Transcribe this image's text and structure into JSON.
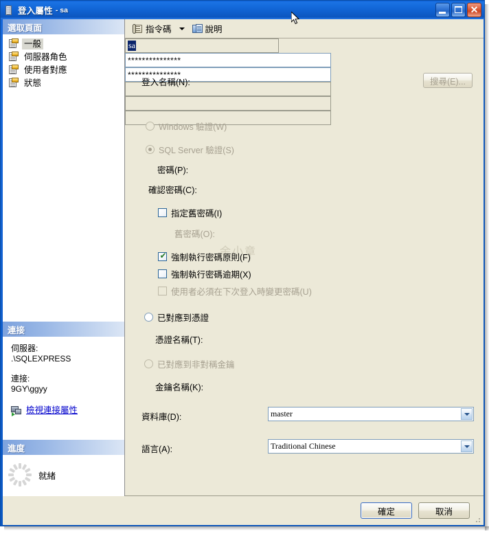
{
  "window": {
    "title": "登入屬性",
    "title_suffix": "- sa",
    "buttons": {
      "minimize": "_",
      "maximize": "□",
      "close": "✕"
    }
  },
  "sidebar": {
    "header": "選取頁面",
    "items": [
      {
        "label": "一般",
        "selected": true
      },
      {
        "label": "伺服器角色",
        "selected": false
      },
      {
        "label": "使用者對應",
        "selected": false
      },
      {
        "label": "狀態",
        "selected": false
      }
    ],
    "connection": {
      "header": "連接",
      "server_label": "伺服器:",
      "server_value": ".\\SQLEXPRESS",
      "connection_label": "連接:",
      "connection_value": "9GY\\ggyy",
      "link": "檢視連接屬性"
    },
    "progress": {
      "header": "進度",
      "status": "就緒"
    }
  },
  "toolbar": {
    "script_label": "指令碼",
    "help_label": "說明"
  },
  "form": {
    "login_name_label": "登入名稱(N):",
    "login_name_value": "sa",
    "search_button": "搜尋(E)...",
    "windows_auth_label": "Windows 驗證(W)",
    "windows_auth_selected": false,
    "windows_auth_disabled": true,
    "sql_auth_label": "SQL Server 驗證(S)",
    "sql_auth_selected": true,
    "sql_auth_disabled": true,
    "password_label": "密碼(P):",
    "password_value": "***************",
    "confirm_password_label": "確認密碼(C):",
    "confirm_password_value": "***************",
    "specify_old_password_label": "指定舊密碼(I)",
    "specify_old_password_checked": false,
    "old_password_label": "舊密碼(O):",
    "old_password_value": "",
    "enforce_policy_label": "強制執行密碼原則(F)",
    "enforce_policy_checked": true,
    "enforce_expiration_label": "強制執行密碼逾期(X)",
    "enforce_expiration_checked": false,
    "must_change_label": "使用者必須在下次登入時變更密碼(U)",
    "must_change_checked": false,
    "must_change_disabled": true,
    "mapped_to_certificate_label": "已對應到憑證",
    "mapped_to_certificate_selected": false,
    "certificate_name_label": "憑證名稱(T):",
    "certificate_name_value": "",
    "mapped_to_asymmetric_key_label": "已對應到非對稱金鑰",
    "mapped_to_asymmetric_key_selected": false,
    "mapped_to_asymmetric_key_disabled": true,
    "key_name_label": "金鑰名稱(K):",
    "key_name_value": "",
    "database_label": "資料庫(D):",
    "database_value": "master",
    "language_label": "語言(A):",
    "language_value": "Traditional Chinese"
  },
  "footer": {
    "ok": "確定",
    "cancel": "取消"
  },
  "watermark": "余小章",
  "colors": {
    "title_blue": "#0a5fd0",
    "dialog_face": "#ece9d8",
    "panel_header": "#9ab8e6",
    "link": "#0000cc",
    "selection": "#0a246a",
    "check_green": "#2a7a2a"
  }
}
